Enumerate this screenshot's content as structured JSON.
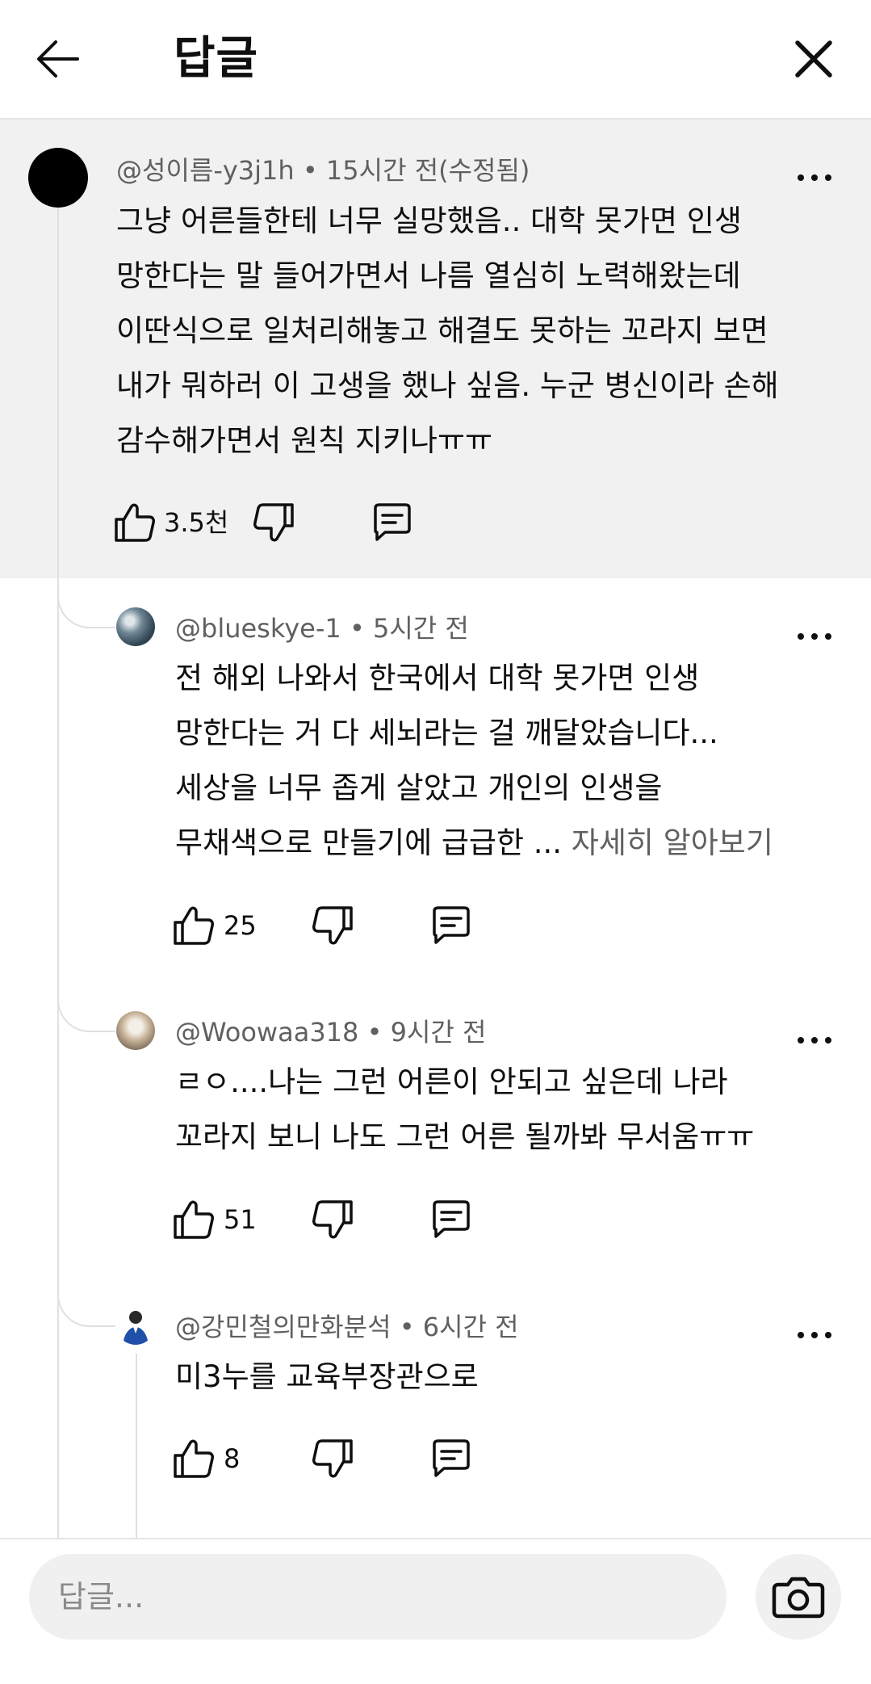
{
  "header": {
    "title": "답글"
  },
  "parent_comment": {
    "author": "@성이름-y3j1h",
    "time": "15시간 전(수정됨)",
    "text": "그냥 어른들한테 너무 실망했음.. 대학 못가면 인생\n망한다는 말 들어가면서 나름 열심히 노력해왔는데\n이딴식으로 일처리해놓고 해결도 못하는 꼬라지 보면\n내가 뭐하러 이 고생을 했나 싶음. 누군 병신이라 손해\n감수해가면서 원칙 지키나ㅠㅠ",
    "likes": "3.5천"
  },
  "replies": [
    {
      "author": "@blueskye-1",
      "time": "5시간 전",
      "text": "전 해외 나와서 한국에서 대학 못가면 인생\n망한다는 거 다 세뇌라는 걸 깨달았습니다...\n세상을 너무 좁게 살았고 개인의 인생을\n무채색으로 만들기에 급급한 ... ",
      "read_more": "자세히 알아보기",
      "likes": "25"
    },
    {
      "author": "@Woowaa318",
      "time": "9시간 전",
      "text": "ㄹㅇ....나는 그런 어른이 안되고 싶은데 나라\n꼬라지 보니 나도 그런 어른 될까봐 무서움ㅠㅠ",
      "likes": "51"
    },
    {
      "author": "@강민철의만화분석",
      "time": "6시간 전",
      "text": "미3누를 교육부장관으로",
      "likes": "8"
    }
  ],
  "separator": "•",
  "reply_input": {
    "placeholder": "답글..."
  },
  "icons": {
    "back": "arrow-left-icon",
    "close": "close-icon",
    "more": "more-horizontal-icon",
    "like": "thumb-up-icon",
    "dislike": "thumb-down-icon",
    "reply": "comment-icon",
    "camera": "camera-icon"
  },
  "colors": {
    "highlight_bg": "#f1f1f1",
    "meta_text": "#606060",
    "input_bg": "#f0f0f0"
  }
}
